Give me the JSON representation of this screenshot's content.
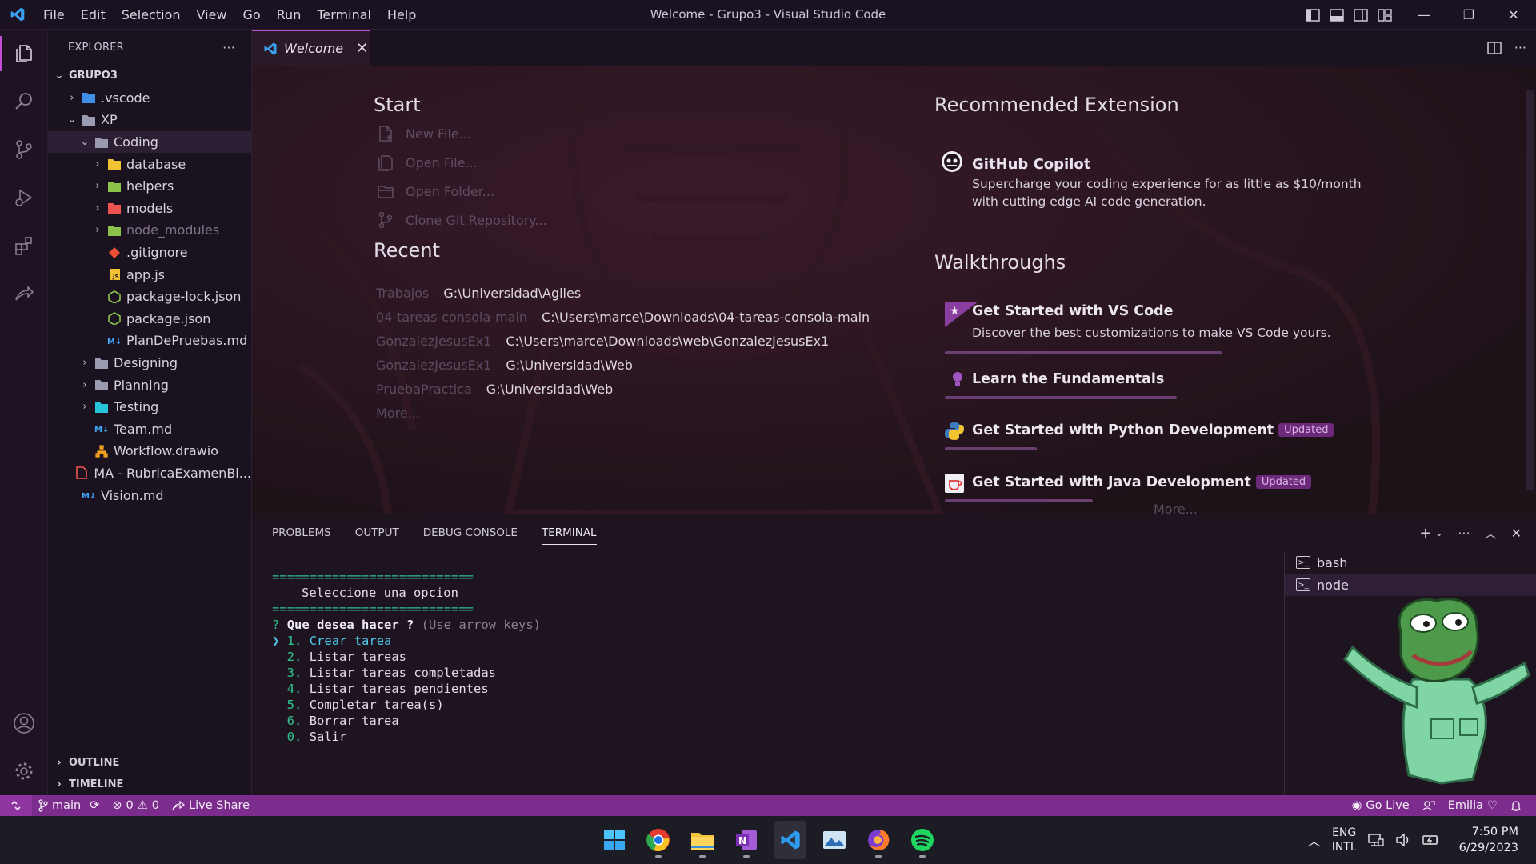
{
  "window": {
    "title": "Welcome - Grupo3 - Visual Studio Code",
    "menu": [
      "File",
      "Edit",
      "Selection",
      "View",
      "Go",
      "Run",
      "Terminal",
      "Help"
    ]
  },
  "sidebar": {
    "header": "EXPLORER",
    "more": "···",
    "root": "GRUPO3",
    "tree": [
      {
        "label": ".vscode",
        "depth": 1,
        "chev": "›",
        "icon": "folder-vscode-icon",
        "color": "#3f8ee8"
      },
      {
        "label": "XP",
        "depth": 1,
        "chev": "⌄",
        "icon": "folder-open-icon",
        "color": "#9a9ab0"
      },
      {
        "label": "Coding",
        "depth": 2,
        "chev": "⌄",
        "icon": "folder-open-icon",
        "color": "#9a9ab0",
        "selected": true
      },
      {
        "label": "database",
        "depth": 3,
        "chev": "›",
        "icon": "folder-database-icon",
        "color": "#f1c232"
      },
      {
        "label": "helpers",
        "depth": 3,
        "chev": "›",
        "icon": "folder-helpers-icon",
        "color": "#8bc34a"
      },
      {
        "label": "models",
        "depth": 3,
        "chev": "›",
        "icon": "folder-models-icon",
        "color": "#ef5350"
      },
      {
        "label": "node_modules",
        "depth": 3,
        "chev": "›",
        "icon": "folder-node-icon",
        "color": "#8bc34a",
        "dim": true
      },
      {
        "label": ".gitignore",
        "depth": 3,
        "chev": "",
        "icon": "git-file-icon",
        "color": "#f05133"
      },
      {
        "label": "app.js",
        "depth": 3,
        "chev": "",
        "icon": "javascript-file-icon",
        "color": "#f1c232"
      },
      {
        "label": "package-lock.json",
        "depth": 3,
        "chev": "",
        "icon": "nodejs-file-icon",
        "color": "#8bc34a"
      },
      {
        "label": "package.json",
        "depth": 3,
        "chev": "",
        "icon": "nodejs-file-icon",
        "color": "#8bc34a"
      },
      {
        "label": "PlanDePruebas.md",
        "depth": 3,
        "chev": "",
        "icon": "markdown-file-icon",
        "color": "#42a5f5"
      },
      {
        "label": "Designing",
        "depth": 2,
        "chev": "›",
        "icon": "folder-icon",
        "color": "#9a9ab0"
      },
      {
        "label": "Planning",
        "depth": 2,
        "chev": "›",
        "icon": "folder-icon",
        "color": "#9a9ab0"
      },
      {
        "label": "Testing",
        "depth": 2,
        "chev": "›",
        "icon": "folder-test-icon",
        "color": "#26c6da"
      },
      {
        "label": "Team.md",
        "depth": 2,
        "chev": "",
        "icon": "markdown-file-icon",
        "color": "#42a5f5"
      },
      {
        "label": "Workflow.drawio",
        "depth": 2,
        "chev": "",
        "icon": "drawio-file-icon",
        "color": "#f0a020"
      },
      {
        "label": "MA - RubricaExamenBi...",
        "depth": 1,
        "chev": "",
        "icon": "pdf-file-icon",
        "color": "#ef5350"
      },
      {
        "label": "Vision.md",
        "depth": 1,
        "chev": "",
        "icon": "markdown-file-icon",
        "color": "#42a5f5"
      }
    ],
    "outline": "OUTLINE",
    "timeline": "TIMELINE"
  },
  "editor": {
    "tab_label": "Welcome",
    "start": {
      "heading": "Start",
      "items": [
        "New File...",
        "Open File...",
        "Open Folder...",
        "Clone Git Repository..."
      ]
    },
    "recent": {
      "heading": "Recent",
      "items": [
        {
          "name": "Trabajos",
          "path": "G:\\Universidad\\Agiles"
        },
        {
          "name": "04-tareas-consola-main",
          "path": "C:\\Users\\marce\\Downloads\\04-tareas-consola-main"
        },
        {
          "name": "GonzalezJesusEx1",
          "path": "C:\\Users\\marce\\Downloads\\web\\GonzalezJesusEx1"
        },
        {
          "name": "GonzalezJesusEx1",
          "path": "G:\\Universidad\\Web"
        },
        {
          "name": "PruebaPractica",
          "path": "G:\\Universidad\\Web"
        }
      ],
      "more": "More..."
    },
    "recommended": {
      "heading": "Recommended Extension",
      "title": "GitHub Copilot",
      "description": "Supercharge your coding experience for as little as $10/month with cutting edge AI code generation."
    },
    "walkthroughs": {
      "heading": "Walkthroughs",
      "items": [
        {
          "title": "Get Started with VS Code",
          "description": "Discover the best customizations to make VS Code yours.",
          "badge": "",
          "progress": 0.47
        },
        {
          "title": "Learn the Fundamentals",
          "description": "",
          "badge": "",
          "progress": 0.45
        },
        {
          "title": "Get Started with Python Development",
          "description": "",
          "badge": "Updated",
          "progress": 0.18
        },
        {
          "title": "Get Started with Java Development",
          "description": "",
          "badge": "Updated",
          "progress": 0.3
        }
      ],
      "more": "More..."
    }
  },
  "panel": {
    "tabs": [
      "PROBLEMS",
      "OUTPUT",
      "DEBUG CONSOLE",
      "TERMINAL"
    ],
    "active_tab": "TERMINAL",
    "terminal": {
      "rule": "===========================",
      "menu_title": "Seleccione una opcion",
      "prompt_mark": "?",
      "question": "Que desea hacer ?",
      "hint": "(Use arrow keys)",
      "cursor": "❯",
      "options": [
        {
          "num": "1.",
          "label": "Crear tarea",
          "selected": true
        },
        {
          "num": "2.",
          "label": "Listar tareas"
        },
        {
          "num": "3.",
          "label": "Listar tareas completadas"
        },
        {
          "num": "4.",
          "label": "Listar tareas pendientes"
        },
        {
          "num": "5.",
          "label": "Completar tarea(s)"
        },
        {
          "num": "6.",
          "label": "Borrar tarea"
        },
        {
          "num": "0.",
          "label": "Salir"
        }
      ]
    },
    "terminals": [
      "bash",
      "node"
    ],
    "active_terminal": "node"
  },
  "statusbar": {
    "branch": "main",
    "errors": "0",
    "warnings": "0",
    "live_share": "Live Share",
    "go_live": "Go Live",
    "theme": "Emilia"
  },
  "taskbar": {
    "apps": [
      "windows-start-icon",
      "chrome-icon",
      "file-explorer-icon",
      "onenote-icon",
      "vscode-icon",
      "photos-icon",
      "firefox-icon",
      "spotify-icon"
    ],
    "lang_top": "ENG",
    "lang_bottom": "INTL",
    "time": "7:50 PM",
    "date": "6/29/2023"
  },
  "colors": {
    "accent": "#b44fd0",
    "statusbar": "#7b2c8c",
    "terminal_green": "#2fc38f",
    "terminal_cyan": "#4ec6e8"
  }
}
